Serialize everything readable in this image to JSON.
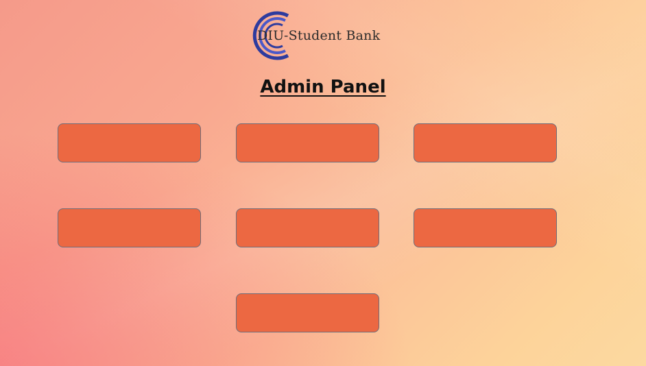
{
  "brand": {
    "name": "DIU-Student Bank",
    "logo_icon": "c-ring-logo-icon",
    "logo_colors": [
      "#2e3b9e",
      "#4b58c8"
    ]
  },
  "page_title": "Admin Panel",
  "colors": {
    "button_fill": "#ec6842",
    "button_border": "#6d6d7a"
  },
  "buttons": [
    {
      "label": ""
    },
    {
      "label": ""
    },
    {
      "label": ""
    },
    {
      "label": ""
    },
    {
      "label": ""
    },
    {
      "label": ""
    },
    {
      "label": ""
    }
  ]
}
